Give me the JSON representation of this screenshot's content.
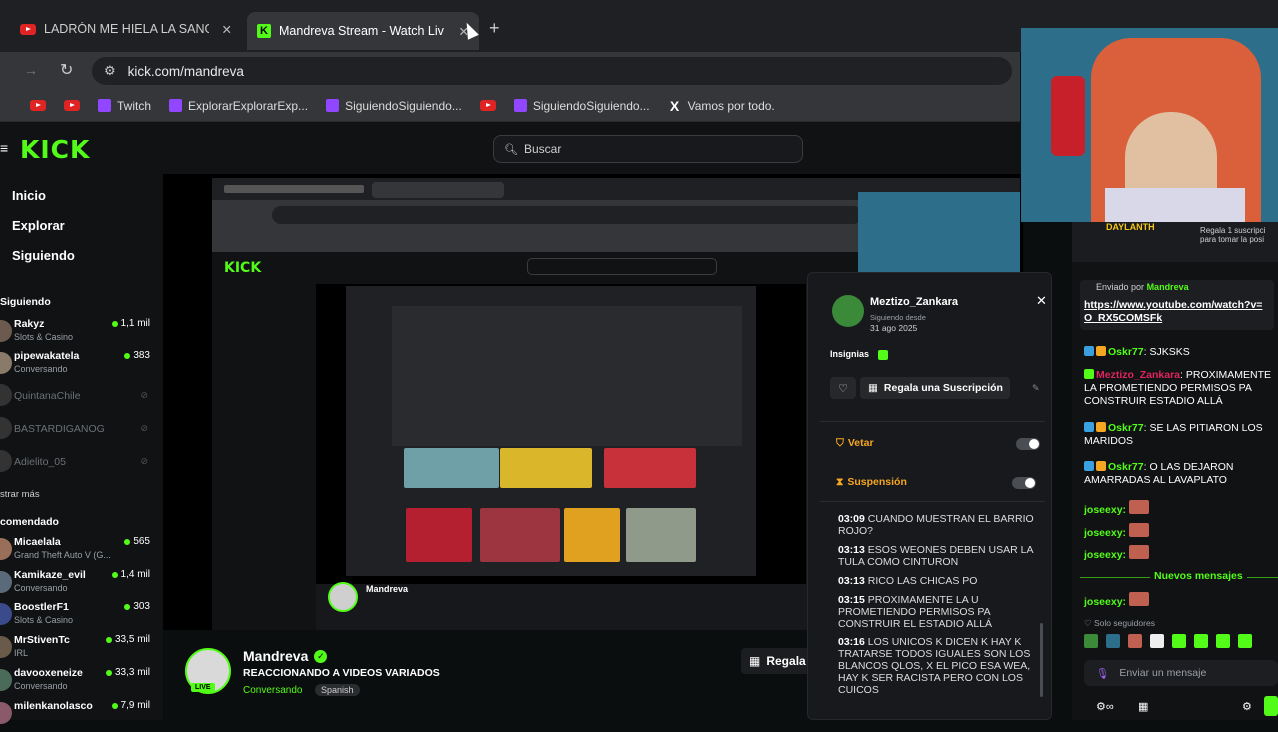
{
  "browser": {
    "tabs": [
      {
        "label": "LADRÓN ME HIELA LA SANGRE",
        "icon": "youtube-icon"
      },
      {
        "label": "Mandreva Stream - Watch Live",
        "icon": "kick-icon"
      }
    ],
    "url": "kick.com/mandreva",
    "bookmarks": [
      "Twitch",
      "ExplorarExplorarExp...",
      "SiguiendoSiguiendo...",
      "SiguiendoSiguiendo...",
      "Vamos por todo."
    ]
  },
  "kick": {
    "logo": "KICK",
    "search_placeholder": "Buscar",
    "nav": [
      "Inicio",
      "Explorar",
      "Siguiendo"
    ],
    "following_header": "Siguiendo",
    "following": [
      {
        "name": "Rakyz",
        "category": "Slots & Casino",
        "viewers": "1,1 mil"
      },
      {
        "name": "pipewakatela",
        "category": "Conversando",
        "viewers": "383"
      }
    ],
    "offline": [
      "QuintanaChile",
      "BASTARDIGANOG",
      "Adielito_05"
    ],
    "show_more": "strar más",
    "recommended_header": "comendado",
    "recommended": [
      {
        "name": "Micaelala",
        "category": "Grand Theft Auto V (G...",
        "viewers": "565"
      },
      {
        "name": "Kamikaze_evil",
        "category": "Conversando",
        "viewers": "1,4 mil"
      },
      {
        "name": "BoostlerF1",
        "category": "Slots & Casino",
        "viewers": "303"
      },
      {
        "name": "MrStivenTc",
        "category": "IRL",
        "viewers": "33,5 mil"
      },
      {
        "name": "davooxeneize",
        "category": "Conversando",
        "viewers": "33,3 mil"
      },
      {
        "name": "milenkanolasco",
        "category": "",
        "viewers": "7,9 mil"
      }
    ]
  },
  "streamer": {
    "name": "Mandreva",
    "title": "REACCIONANDO A VIDEOS VARIADOS",
    "category": "Conversando",
    "tag": "Spanish",
    "live": "LIVE",
    "sub_button": "Regala S"
  },
  "popup": {
    "user": "Meztizo_Zankara",
    "since_label": "Siguiendo desde",
    "since": "31 ago 2025",
    "badges_label": "Insignias",
    "gift_button": "Regala una Suscripción",
    "vetar": "Vetar",
    "suspension": "Suspensión",
    "log": [
      {
        "time": "03:09",
        "text": "CUANDO MUESTRAN EL BARRIO ROJO?"
      },
      {
        "time": "03:13",
        "text": "ESOS WEONES DEBEN USAR LA TULA COMO CINTURON"
      },
      {
        "time": "03:13",
        "text": "RICO LAS CHICAS PO"
      },
      {
        "time": "03:15",
        "text": "PROXIMAMENTE LA U PROMETIENDO PERMISOS PA CONSTRUIR EL ESTADIO ALLÁ"
      },
      {
        "time": "03:16",
        "text": "LOS UNICOS K DICEN K HAY K TRATARSE TODOS IGUALES SON LOS BLANCOS QLOS, X EL PICO ESA WEA, HAY K SER RACISTA PERO CON LOS CUICOS"
      }
    ]
  },
  "chat": {
    "top_notice": "Regala 1 suscripci para tomar la posi",
    "top_user": "DAYLANTH",
    "sent_by_label": "Enviado por",
    "sent_by_user": "Mandreva",
    "link": "https://www.youtube.com/watch?v=O_RX5COMSFk",
    "messages": [
      {
        "user": "Oskr77",
        "text": "SJKSKS"
      },
      {
        "user": "Meztizo_Zankara",
        "text": "PROXIMAMENTE LA PROMETIENDO PERMISOS PA CONSTRUIR ESTADIO ALLÁ"
      },
      {
        "user": "Oskr77",
        "text": "SE LAS PITIARON LOS MARIDOS"
      },
      {
        "user": "Oskr77",
        "text": "O LAS DEJARON AMARRADAS AL LAVAPLATO"
      }
    ],
    "emote_user": "joseexy:",
    "new_messages": "Nuevos mensajes",
    "followers_only": "Solo seguidores",
    "input_placeholder": "Enviar un mensaje"
  },
  "colors": {
    "kick_green": "#53fc18",
    "bg": "#0b0e0f",
    "red": "#e02424"
  }
}
